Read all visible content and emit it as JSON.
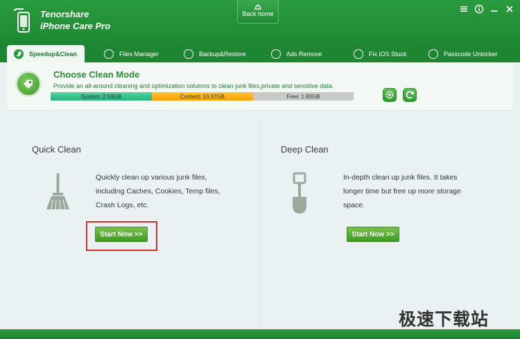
{
  "app": {
    "brand": "Tenorshare",
    "name": "iPhone Care Pro"
  },
  "header": {
    "back_home": "Back home"
  },
  "tabs": [
    {
      "label": "Speedup&Clean",
      "icon": "rocket-icon"
    },
    {
      "label": "Files Manager",
      "icon": "files-icon"
    },
    {
      "label": "Backup&Restore",
      "icon": "backup-icon"
    },
    {
      "label": "Ads Remove",
      "icon": "ads-icon"
    },
    {
      "label": "Fix iOS Stuck",
      "icon": "fix-icon"
    },
    {
      "label": "Passcode Unlocker",
      "icon": "key-icon"
    }
  ],
  "mode": {
    "title": "Choose Clean Mode",
    "description": "Provide an all-around cleaning and optimization solutons to clean junk files,private and sensitive data.",
    "storage": {
      "system": "System: 2.59GB",
      "content": "Content: 10.37GB",
      "free": "Free: 1.80GB"
    }
  },
  "quick": {
    "title": "Quick Clean",
    "description": "Quickly clean up various junk files, including Caches, Cookies, Temp files, Crash Logs, etc.",
    "button": "Start Now >>"
  },
  "deep": {
    "title": "Deep Clean",
    "description": "In-depth clean up junk files. It takes longer time but free up more storage space.",
    "button": "Start Now >>"
  },
  "watermark": "极速下载站",
  "colors": {
    "brand_green": "#2a9a3e",
    "highlight": "#d03030"
  }
}
